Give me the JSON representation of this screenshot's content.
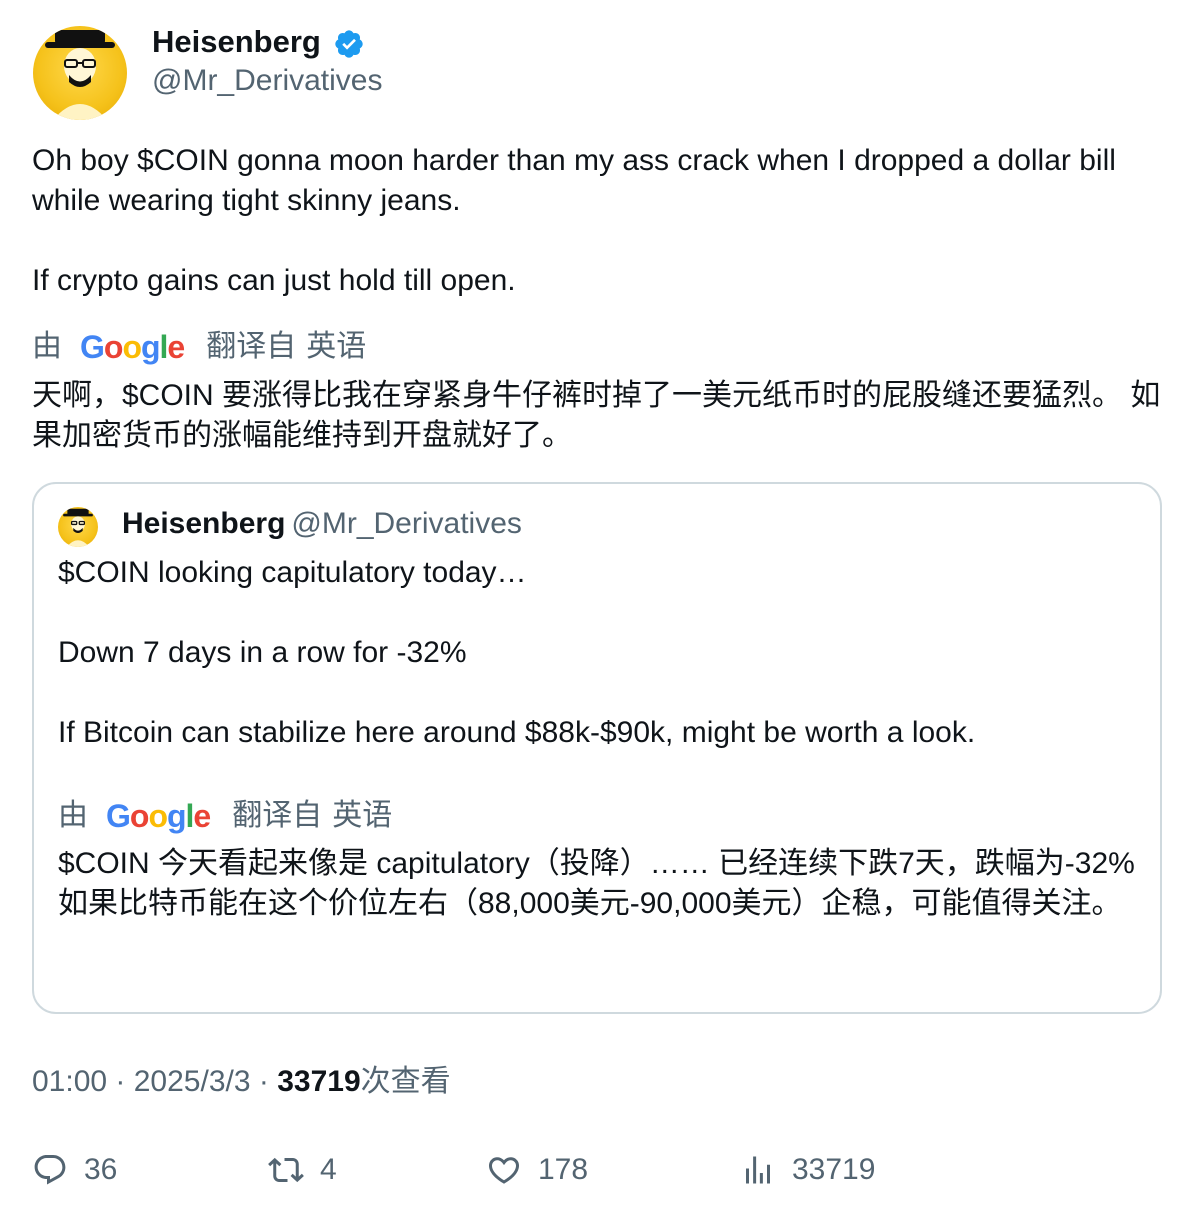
{
  "author": {
    "name": "Heisenberg",
    "handle": "@Mr_Derivatives"
  },
  "tweet": {
    "text": "Oh boy $COIN gonna moon harder than my ass crack when I dropped a dollar bill while wearing tight skinny jeans.\n\nIf crypto gains can just hold till open.",
    "translation": {
      "by_label": "由",
      "provider": "Google",
      "from_label": "翻译自",
      "language": "英语",
      "text": "天啊，$COIN 要涨得比我在穿紧身牛仔裤时掉了一美元纸币时的屁股缝还要猛烈。 如果加密货币的涨幅能维持到开盘就好了。"
    }
  },
  "quoted": {
    "name": "Heisenberg",
    "handle": "@Mr_Derivatives",
    "text": "$COIN looking capitulatory today…\n\nDown 7 days in a row for -32%\n\nIf Bitcoin can stabilize here around $88k-$90k, might be worth a look.",
    "translation": {
      "by_label": "由",
      "provider": "Google",
      "from_label": "翻译自",
      "language": "英语",
      "text": "$COIN 今天看起来像是 capitulatory（投降）…… 已经连续下跌7天，跌幅为-32% 如果比特币能在这个价位左右（88,000美元-90,000美元）企稳，可能值得关注。"
    }
  },
  "meta": {
    "time": "01:00",
    "separator": " · ",
    "date": "2025/3/3",
    "views_count": "33719",
    "views_label": "次查看"
  },
  "actions": {
    "replies": "36",
    "reposts": "4",
    "likes": "178",
    "views": "33719"
  },
  "colors": {
    "verified": "#1d9bf0",
    "secondary_text": "#536471",
    "border": "#cfd9de",
    "avatar_yellow": "#f5c21b"
  }
}
